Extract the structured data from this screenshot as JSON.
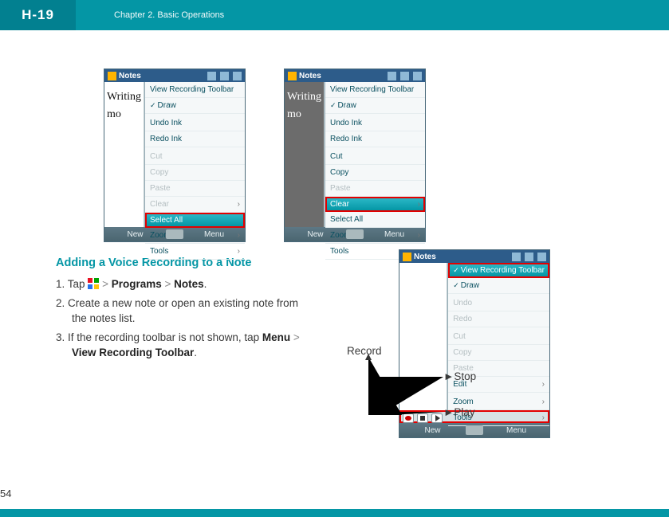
{
  "header": {
    "logo": "H-19",
    "chapter": "Chapter 2. Basic Operations"
  },
  "page_number": "54",
  "section_title": "Adding a Voice Recording to a Note",
  "steps": {
    "s1_prefix": "1. Tap ",
    "s1_gt1": " > ",
    "s1_programs": "Programs",
    "s1_gt2": " > ",
    "s1_notes": "Notes",
    "s1_suffix": ".",
    "s2": "2. Create a new note or open an existing note from the notes list.",
    "s3_prefix": "3. If the recording toolbar is not shown, tap ",
    "s3_menu": "Menu",
    "s3_gt": " > ",
    "s3_vrt": "View Recording Toolbar",
    "s3_suffix": "."
  },
  "device_common": {
    "title": "Notes",
    "soft_left": "New",
    "soft_right": "Menu",
    "ink_text1": "Writing",
    "ink_text2": "mo"
  },
  "menu_a": {
    "m1": "View Recording Toolbar",
    "m2": "Draw",
    "m3": "Undo Ink",
    "m4": "Redo Ink",
    "m5": "Cut",
    "m6": "Copy",
    "m7": "Paste",
    "m8": "Clear",
    "m9": "Select All",
    "m10": "Zoom",
    "m11": "Tools"
  },
  "menu_b": {
    "m1": "View Recording Toolbar",
    "m2": "Draw",
    "m3": "Undo Ink",
    "m4": "Redo Ink",
    "m5": "Cut",
    "m6": "Copy",
    "m7": "Paste",
    "m8": "Clear",
    "m9": "Select All",
    "m10": "Zoom",
    "m11": "Tools"
  },
  "menu_c": {
    "m1": "View Recording Toolbar",
    "m2": "Draw",
    "m3": "Undo",
    "m4": "Redo",
    "m5": "Cut",
    "m6": "Copy",
    "m7": "Paste",
    "m8": "Edit",
    "m9": "Zoom",
    "m10": "Tools"
  },
  "callouts": {
    "record": "Record",
    "stop": "Stop",
    "play": "Play"
  }
}
